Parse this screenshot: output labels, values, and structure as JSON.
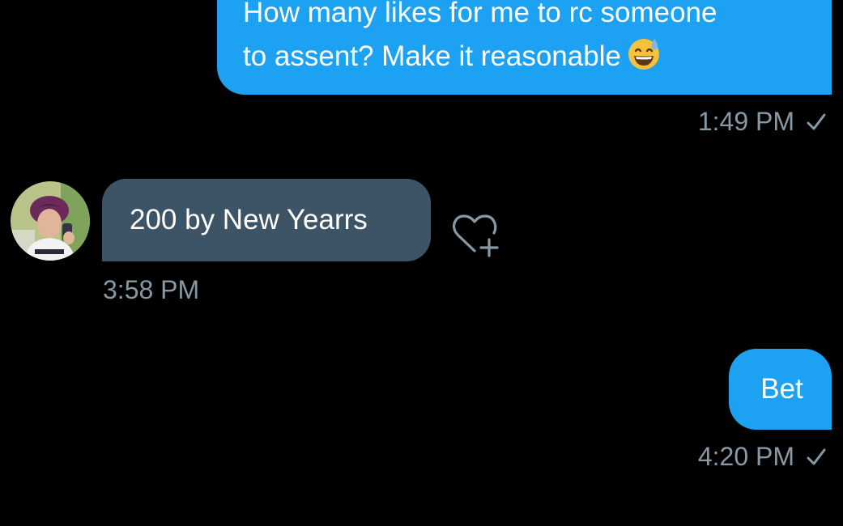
{
  "messages": [
    {
      "direction": "outgoing",
      "line1": "How many likes for me to rc someone",
      "line2": "to assent? Make it reasonable",
      "emoji": "grinning-face-with-sweat-icon",
      "time": "1:49 PM",
      "status_icon": "check-icon"
    },
    {
      "direction": "incoming",
      "avatar": "user-avatar",
      "text": "200 by New Yearrs",
      "time": "3:58 PM",
      "reaction_icon": "heart-plus-icon"
    },
    {
      "direction": "outgoing",
      "text": "Bet",
      "time": "4:20 PM",
      "status_icon": "check-icon"
    }
  ],
  "colors": {
    "background": "#000000",
    "outgoing_bubble": "#1da1f2",
    "incoming_bubble": "#3d5466",
    "meta_text": "#8899a6",
    "message_text": "#ffffff"
  }
}
